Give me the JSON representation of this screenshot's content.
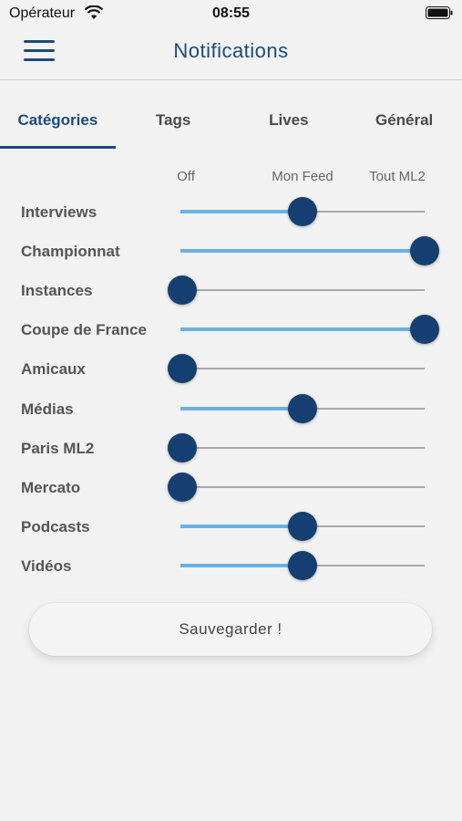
{
  "status_bar": {
    "carrier": "Opérateur",
    "time": "08:55"
  },
  "header": {
    "title": "Notifications",
    "menu_icon": "hamburger-menu-icon"
  },
  "tabs": [
    {
      "label": "Catégories",
      "active": true
    },
    {
      "label": "Tags",
      "active": false
    },
    {
      "label": "Lives",
      "active": false
    },
    {
      "label": "Général",
      "active": false
    }
  ],
  "columns": [
    "Off",
    "Mon Feed",
    "Tout ML2"
  ],
  "categories": [
    {
      "label": "Interviews",
      "level": 0.5
    },
    {
      "label": "Championnat",
      "level": 1
    },
    {
      "label": "Instances",
      "level": 0
    },
    {
      "label": "Coupe de France",
      "level": 1
    },
    {
      "label": "Amicaux",
      "level": 0
    },
    {
      "label": "Médias",
      "level": 0.5
    },
    {
      "label": "Paris ML2",
      "level": 0
    },
    {
      "label": "Mercato",
      "level": 0
    },
    {
      "label": "Podcasts",
      "level": 0.5
    },
    {
      "label": "Vidéos",
      "level": 0.5
    }
  ],
  "save_label": "Sauvegarder !",
  "colors": {
    "primary": "#1a4a7c",
    "thumb": "#143f70",
    "fill": "#6cb0e3",
    "track": "#a9a9a9",
    "background": "#f2f2f2"
  }
}
